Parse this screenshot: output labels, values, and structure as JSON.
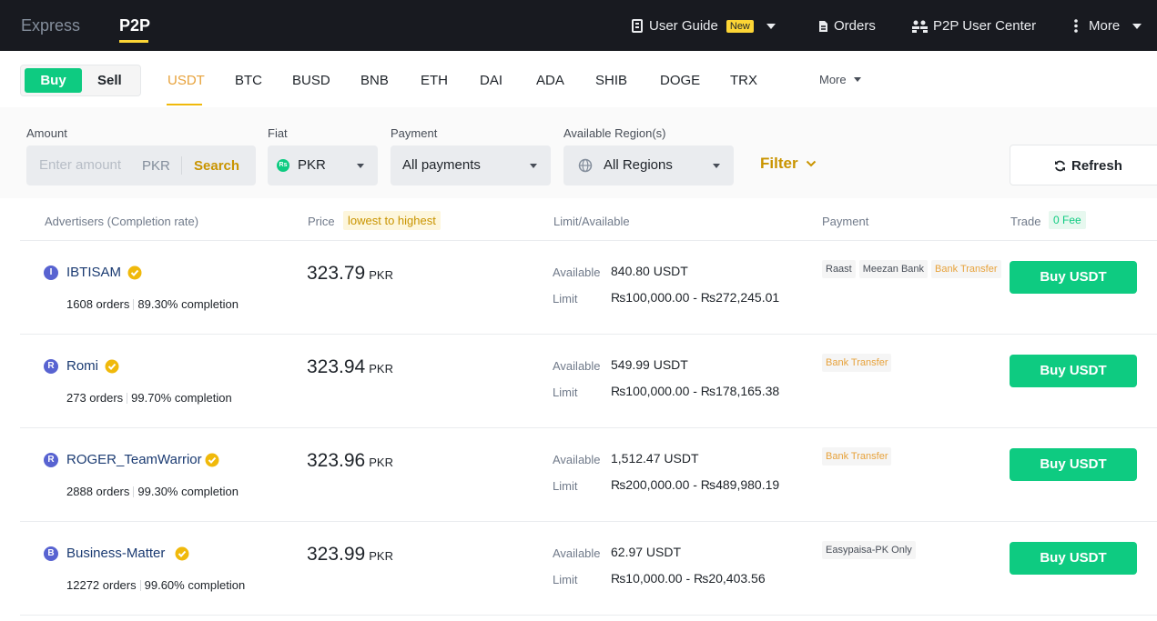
{
  "topbar": {
    "tabs": [
      "Express",
      "P2P"
    ],
    "user_guide": "User Guide",
    "new_badge": "New",
    "orders": "Orders",
    "user_center": "P2P User Center",
    "more": "More"
  },
  "coinbar": {
    "buy": "Buy",
    "sell": "Sell",
    "coins": [
      "USDT",
      "BTC",
      "BUSD",
      "BNB",
      "ETH",
      "DAI",
      "ADA",
      "SHIB",
      "DOGE",
      "TRX"
    ],
    "more": "More"
  },
  "filters": {
    "amount_label": "Amount",
    "amount_placeholder": "Enter amount",
    "amount_unit": "PKR",
    "search": "Search",
    "fiat_label": "Fiat",
    "fiat_icon_text": "Rs",
    "fiat_value": "PKR",
    "payment_label": "Payment",
    "payment_value": "All payments",
    "region_label": "Available Region(s)",
    "region_value": "All Regions",
    "filter": "Filter",
    "refresh": "Refresh"
  },
  "table": {
    "headers": {
      "advertisers": "Advertisers (Completion rate)",
      "price": "Price",
      "price_sort": "lowest to highest",
      "limit": "Limit/Available",
      "payment": "Payment",
      "trade": "Trade",
      "fee": "0 Fee"
    },
    "available_label": "Available",
    "limit_label": "Limit",
    "rows": [
      {
        "initial": "I",
        "name": "IBTISAM",
        "orders": "1608 orders",
        "completion": "89.30% completion",
        "price": "323.79",
        "unit": "PKR",
        "available": "840.80 USDT",
        "limit": "₨100,000.00 - ₨272,245.01",
        "payments": [
          "Raast",
          "Meezan Bank",
          "Bank Transfer"
        ],
        "action": "Buy USDT"
      },
      {
        "initial": "R",
        "name": "Romi",
        "orders": "273 orders",
        "completion": "99.70% completion",
        "price": "323.94",
        "unit": "PKR",
        "available": "549.99 USDT",
        "limit": "₨100,000.00 - ₨178,165.38",
        "payments": [
          "Bank Transfer"
        ],
        "action": "Buy USDT"
      },
      {
        "initial": "R",
        "name": "ROGER_TeamWarrior",
        "orders": "2888 orders",
        "completion": "99.30% completion",
        "price": "323.96",
        "unit": "PKR",
        "available": "1,512.47 USDT",
        "limit": "₨200,000.00 - ₨489,980.19",
        "payments": [
          "Bank Transfer"
        ],
        "action": "Buy USDT"
      },
      {
        "initial": "B",
        "name": "Business-Matter",
        "orders": "12272 orders",
        "completion": "99.60% completion",
        "price": "323.99",
        "unit": "PKR",
        "available": "62.97 USDT",
        "limit": "₨10,000.00 - ₨20,403.56",
        "payments": [
          "Easypaisa-PK Only"
        ],
        "action": "Buy USDT"
      }
    ]
  },
  "colors": {
    "green": "#0ecb81",
    "gold": "#c99400",
    "topbar_bg": "#181a20"
  }
}
